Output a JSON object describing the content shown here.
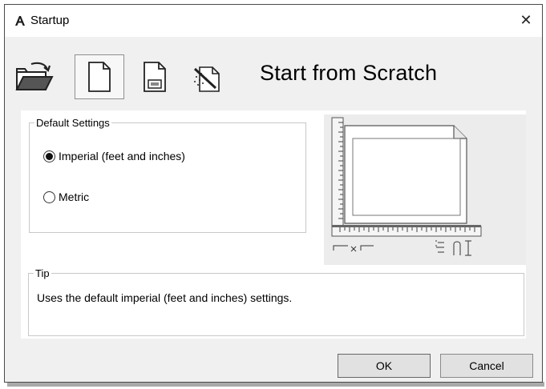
{
  "window": {
    "title": "Startup",
    "close_label": "✕"
  },
  "toolbar": {
    "tools": [
      {
        "name": "open-drawing",
        "icon": "open-folder-icon"
      },
      {
        "name": "start-from-scratch",
        "icon": "blank-page-icon",
        "selected": true
      },
      {
        "name": "use-template",
        "icon": "template-icon"
      },
      {
        "name": "use-wizard",
        "icon": "wizard-icon"
      }
    ],
    "mode_title": "Start from Scratch"
  },
  "default_settings": {
    "legend": "Default Settings",
    "options": [
      {
        "label": "Imperial (feet and inches)",
        "selected": true
      },
      {
        "label": "Metric",
        "selected": false
      }
    ]
  },
  "preview": {
    "icon": "drawing-sheet-preview-icon",
    "caption_width_icon": "width-by-height-icon",
    "caption_units_icon": "units-icon"
  },
  "tip": {
    "legend": "Tip",
    "text": "Uses the default imperial (feet and inches) settings."
  },
  "buttons": {
    "ok": "OK",
    "cancel": "Cancel"
  },
  "colors": {
    "dialog_bg": "#f0f0f0",
    "panel_bg": "#ffffff",
    "preview_bg": "#ececec"
  }
}
